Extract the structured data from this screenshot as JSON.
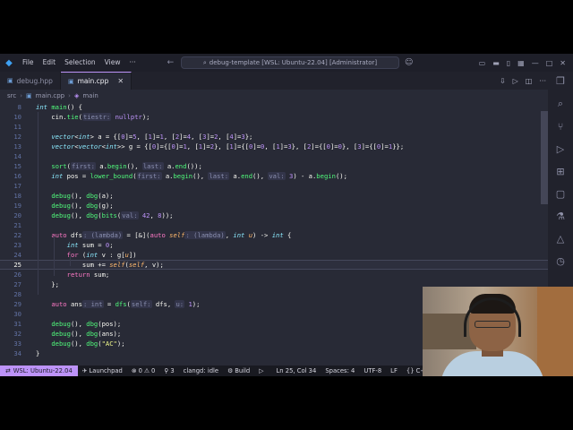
{
  "titlebar": {
    "menu": [
      "File",
      "Edit",
      "Selection",
      "View",
      "···"
    ],
    "search_text": "debug-template [WSL: Ubuntu-22.04] [Administrator]"
  },
  "tabs": [
    {
      "label": "debug.hpp",
      "active": false
    },
    {
      "label": "main.cpp",
      "active": true
    }
  ],
  "breadcrumb": [
    "src",
    "main.cpp",
    "main"
  ],
  "editor": {
    "lines": [
      {
        "n": "8",
        "html": "<span class='ty'>int</span> <span class='fn'>main</span>() {"
      },
      {
        "n": "10",
        "html": "    cin.<span class='fn'>tie</span>(<span class='hint'>tiestr:</span> <span class='num'>nullptr</span>);"
      },
      {
        "n": "11",
        "html": ""
      },
      {
        "n": "12",
        "html": "    <span class='ty'>vector</span>&lt;<span class='ty'>int</span>&gt; a = {[<span class='num'>0</span>]=<span class='num'>5</span>, [<span class='num'>1</span>]=<span class='num'>1</span>, [<span class='num'>2</span>]=<span class='num'>4</span>, [<span class='num'>3</span>]=<span class='num'>2</span>, [<span class='num'>4</span>]=<span class='num'>3</span>};"
      },
      {
        "n": "13",
        "html": "    <span class='ty'>vector</span>&lt;<span class='ty'>vector</span>&lt;<span class='ty'>int</span>&gt;&gt; g = {[<span class='num'>0</span>]={[<span class='num'>0</span>]=<span class='num'>1</span>, [<span class='num'>1</span>]=<span class='num'>2</span>}, [<span class='num'>1</span>]={[<span class='num'>0</span>]=<span class='num'>0</span>, [<span class='num'>1</span>]=<span class='num'>3</span>}, [<span class='num'>2</span>]={[<span class='num'>0</span>]=<span class='num'>0</span>}, [<span class='num'>3</span>]={[<span class='num'>0</span>]=<span class='num'>1</span>}};"
      },
      {
        "n": "14",
        "html": ""
      },
      {
        "n": "15",
        "html": "    <span class='fn'>sort</span>(<span class='hint'>first:</span> a.<span class='fn'>begin</span>(), <span class='hint'>last:</span> a.<span class='fn'>end</span>());"
      },
      {
        "n": "16",
        "html": "    <span class='ty'>int</span> pos = <span class='fn'>lower_bound</span>(<span class='hint'>first:</span> a.<span class='fn'>begin</span>(), <span class='hint'>last:</span> a.<span class='fn'>end</span>(), <span class='hint'>val:</span> <span class='num'>3</span>) - a.<span class='fn'>begin</span>();"
      },
      {
        "n": "17",
        "html": ""
      },
      {
        "n": "18",
        "html": "    <span class='fn'>debug</span>(), <span class='fn'>dbg</span>(a);"
      },
      {
        "n": "19",
        "html": "    <span class='fn'>debug</span>(), <span class='fn'>dbg</span>(g);"
      },
      {
        "n": "20",
        "html": "    <span class='fn'>debug</span>(), <span class='fn'>dbg</span>(<span class='fn'>bits</span>(<span class='hint'>val:</span> <span class='num'>42</span>, <span class='num'>8</span>));"
      },
      {
        "n": "21",
        "html": ""
      },
      {
        "n": "22",
        "html": "    <span class='kw'>auto</span> dfs<span class='hint'>: (lambda)</span> = [&amp;](<span class='kw'>auto</span> <span class='it'>self</span><span class='hint'>: (lambda)</span>, <span class='ty'>int</span> <span class='it'>u</span>) -&gt; <span class='ty'>int</span> {"
      },
      {
        "n": "23",
        "html": "        <span class='ty'>int</span> sum = <span class='num'>0</span>;"
      },
      {
        "n": "24",
        "html": "        <span class='kw'>for</span> (<span class='ty'>int</span> v : g[<span class='it'>u</span>])"
      },
      {
        "n": "25",
        "html": "            sum += <span class='it'>self</span>(<span class='it'>self</span>, v);",
        "current": true
      },
      {
        "n": "26",
        "html": "        <span class='kw'>return</span> sum;"
      },
      {
        "n": "27",
        "html": "    };"
      },
      {
        "n": "28",
        "html": ""
      },
      {
        "n": "29",
        "html": "    <span class='kw'>auto</span> ans<span class='hint'>: int</span> = <span class='fn'>dfs</span>(<span class='hint'>self:</span> dfs, <span class='hint'>u:</span> <span class='num'>1</span>);"
      },
      {
        "n": "30",
        "html": ""
      },
      {
        "n": "31",
        "html": "    <span class='fn'>debug</span>(), <span class='fn'>dbg</span>(pos);"
      },
      {
        "n": "32",
        "html": "    <span class='fn'>debug</span>(), <span class='fn'>dbg</span>(ans);"
      },
      {
        "n": "33",
        "html": "    <span class='fn'>debug</span>(), <span class='fn'>dbg</span>(<span class='str'>\"AC\"</span>);"
      },
      {
        "n": "34",
        "html": "}"
      }
    ]
  },
  "statusbar": {
    "remote": "WSL: Ubuntu-22.04",
    "launchpad": "Launchpad",
    "errors": "0",
    "warnings": "0",
    "extensions": "3",
    "clangd": "clangd: idle",
    "build": "Build",
    "position": "Ln 25, Col 34",
    "spaces": "Spaces: 4",
    "encoding": "UTF-8",
    "eol": "LF",
    "language": "{} C+"
  },
  "colors": {
    "editor_bg": "#282a36",
    "accent": "#bd93f9",
    "keyword": "#ff79c6",
    "function": "#50fa7b",
    "number": "#bd93f9"
  }
}
